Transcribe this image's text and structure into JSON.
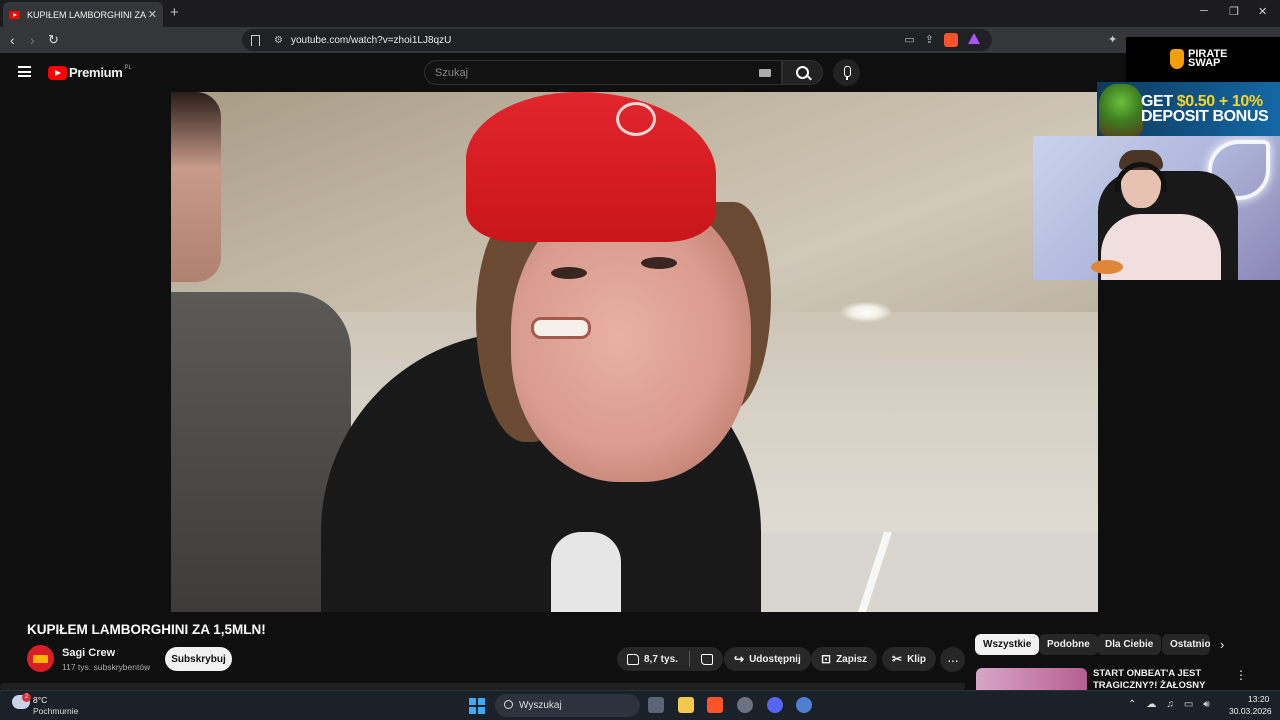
{
  "browser": {
    "tab_title": "KUPIŁEM LAMBORGHINI ZA",
    "new_tab": "+",
    "url": "youtube.com/watch?v=zhoi1LJ8qzU",
    "window_controls": {
      "minimize": "─",
      "restore": "❐",
      "close": "✕"
    }
  },
  "youtube": {
    "brand": "Premium",
    "region": "PL",
    "search_placeholder": "Szukaj"
  },
  "ads": {
    "pirateswap": "PIRATE SWAP",
    "bonus_line1_prefix": "GET ",
    "bonus_line1_amount": "$0.50 + 10%",
    "bonus_line2": "DEPOSIT BONUS"
  },
  "video": {
    "title": "KUPIŁEM LAMBORGHINI ZA 1,5MLN!",
    "channel_name": "Sagi Crew",
    "subscribers": "117 tys. subskrybentów",
    "subscribe_label": "Subskrybuj",
    "likes": "8,7 tys.",
    "share_label": "Udostępnij",
    "save_label": "Zapisz",
    "clip_label": "Klip",
    "more_label": "···"
  },
  "related": {
    "chips": [
      "Wszystkie",
      "Podobne",
      "Dla Ciebie",
      "Ostatnio"
    ],
    "first_title": "START ONBEAT'A JEST TRAGICZNY?! ŻAŁOSNY"
  },
  "taskbar": {
    "weather_temp": "8°C",
    "weather_desc": "Pochmurnie",
    "weather_badge": "2",
    "search_label": "Wyszukaj",
    "time": "13:20",
    "date": "30.03.2026"
  }
}
